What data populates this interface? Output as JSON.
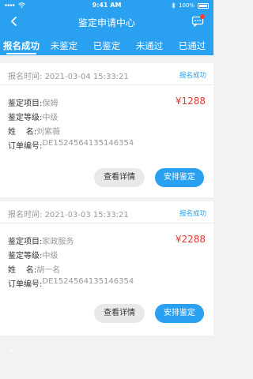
{
  "statusbar": {
    "time": "9:41 AM",
    "battery": "100%"
  },
  "header": {
    "title": "鉴定申请中心"
  },
  "tabs": [
    {
      "label": "报名成功",
      "active": true
    },
    {
      "label": "未鉴定",
      "active": false
    },
    {
      "label": "已鉴定",
      "active": false
    },
    {
      "label": "未通过",
      "active": false
    },
    {
      "label": "已通过",
      "active": false
    }
  ],
  "orders": [
    {
      "time_label": "报名时间:",
      "time": "2021-03-04 15:33:21",
      "status": "报名成功",
      "project_label": "鉴定项目:",
      "project": "保姆",
      "level_label": "鉴定等级:",
      "level": "中级",
      "name_label": "姓    名:",
      "name": "刘紫薇",
      "order_label": "订单编号:",
      "order_no": "DE1524564135146354",
      "price": "¥1288",
      "detail_btn": "查看详情",
      "arrange_btn": "安排鉴定"
    },
    {
      "time_label": "报名时间:",
      "time": "2021-03-03 15:33:21",
      "status": "报名成功",
      "project_label": "鉴定项目:",
      "project": "家政服务",
      "level_label": "鉴定等级:",
      "level": "中级",
      "name_label": "姓    名:",
      "name": "胡一名",
      "order_label": "订单编号:",
      "order_no": "DE1524564135146354",
      "price": "¥2288",
      "detail_btn": "查看详情",
      "arrange_btn": "安排鉴定"
    }
  ],
  "colors": {
    "primary": "#2aa0f0",
    "price": "#e53935",
    "notification": "#ff3b30"
  }
}
